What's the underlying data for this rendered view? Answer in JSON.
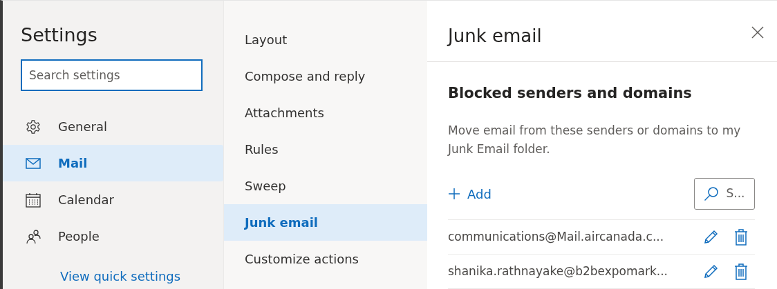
{
  "settings": {
    "title": "Settings",
    "search": {
      "placeholder": "Search settings"
    },
    "nav": [
      {
        "kind": "gear",
        "label": "General",
        "selected": false
      },
      {
        "kind": "mail",
        "label": "Mail",
        "selected": true
      },
      {
        "kind": "calendar",
        "label": "Calendar",
        "selected": false
      },
      {
        "kind": "people",
        "label": "People",
        "selected": false
      }
    ],
    "quick_link": "View quick settings"
  },
  "submenu": [
    {
      "label": "Layout",
      "selected": false
    },
    {
      "label": "Compose and reply",
      "selected": false
    },
    {
      "label": "Attachments",
      "selected": false
    },
    {
      "label": "Rules",
      "selected": false
    },
    {
      "label": "Sweep",
      "selected": false
    },
    {
      "label": "Junk email",
      "selected": true
    },
    {
      "label": "Customize actions",
      "selected": false
    }
  ],
  "panel": {
    "title": "Junk email",
    "section_title": "Blocked senders and domains",
    "description": "Move email from these senders or domains to my Junk Email folder.",
    "add_label": "Add",
    "search_label": "S...",
    "entries": [
      "communications@Mail.aircanada.c...",
      "shanika.rathnayake@b2bexpomark..."
    ]
  }
}
